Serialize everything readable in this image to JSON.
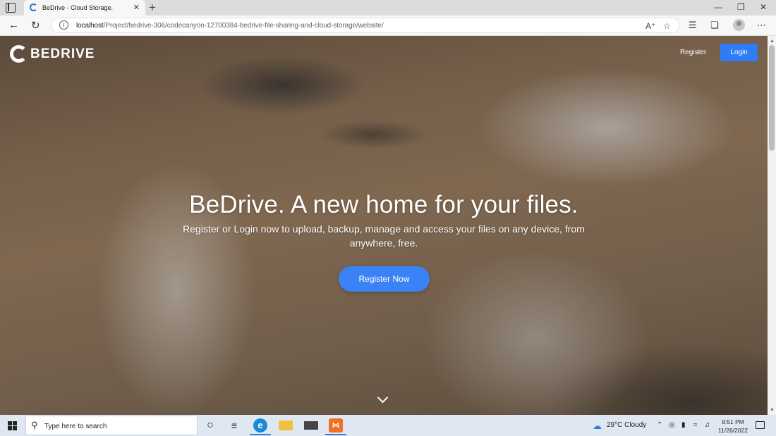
{
  "browser": {
    "tab_title": "BeDrive - Cloud Storage.",
    "tab_close": "✕",
    "new_tab": "+",
    "url_host": "localhost",
    "url_path": "/Project/bedrive-306/codecanyon-12700384-bedrive-file-sharing-and-cloud-storage/website/",
    "window_controls": {
      "minimize": "—",
      "restore": "❐",
      "close": "✕"
    }
  },
  "site": {
    "brand": "BEDRIVE",
    "nav": {
      "register": "Register",
      "login": "Login"
    },
    "hero": {
      "title": "BeDrive. A new home for your files.",
      "subtitle": "Register or Login now to upload, backup, manage and access your files on any device, from anywhere, free.",
      "cta": "Register Now"
    }
  },
  "taskbar": {
    "search_placeholder": "Type here to search",
    "weather": "29°C  Cloudy",
    "time": "9:51 PM",
    "date": "11/26/2022"
  },
  "colors": {
    "primary": "#2f7cf6",
    "taskbar": "#dfe8f2"
  }
}
